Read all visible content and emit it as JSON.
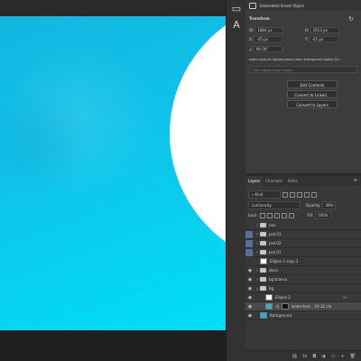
{
  "properties": {
    "header_title": "Embedded Smart Object",
    "section_title": "Transform",
    "w": "1884 px",
    "h": "1913 px",
    "x": "-45 px",
    "y": "-45 px",
    "angle": "90.00°",
    "file_path": "water-texture-ripples-wave-clean-transparent-water-20...",
    "layer_comp_placeholder": "Don't Apply Layer Comp",
    "btn_edit": "Edit Contents",
    "btn_convert_linked": "Convert to Linked...",
    "btn_convert_layers": "Convert to Layers"
  },
  "layers_panel": {
    "tabs": [
      "Layers",
      "Channels",
      "Paths"
    ],
    "filter_kind": "Kind",
    "blend_mode": "Luminosity",
    "opacity_label": "Opacity:",
    "opacity_value": "39%",
    "lock_label": "Lock:",
    "fill_label": "Fill:",
    "fill_value": "100%",
    "items": [
      {
        "name": "nav",
        "type": "group"
      },
      {
        "name": "psd 03",
        "type": "group"
      },
      {
        "name": "psd 02",
        "type": "group"
      },
      {
        "name": "psd 01",
        "type": "group"
      },
      {
        "name": "Ellipse 1 copy 3",
        "type": "shape"
      },
      {
        "name": "deco",
        "type": "group"
      },
      {
        "name": "bg branco",
        "type": "group"
      },
      {
        "name": "bg",
        "type": "group"
      },
      {
        "name": "Ellipse 2",
        "type": "shape"
      },
      {
        "name": "water-text... 04 32 c/o",
        "type": "smart-object"
      },
      {
        "name": "Background",
        "type": "fill"
      }
    ]
  }
}
